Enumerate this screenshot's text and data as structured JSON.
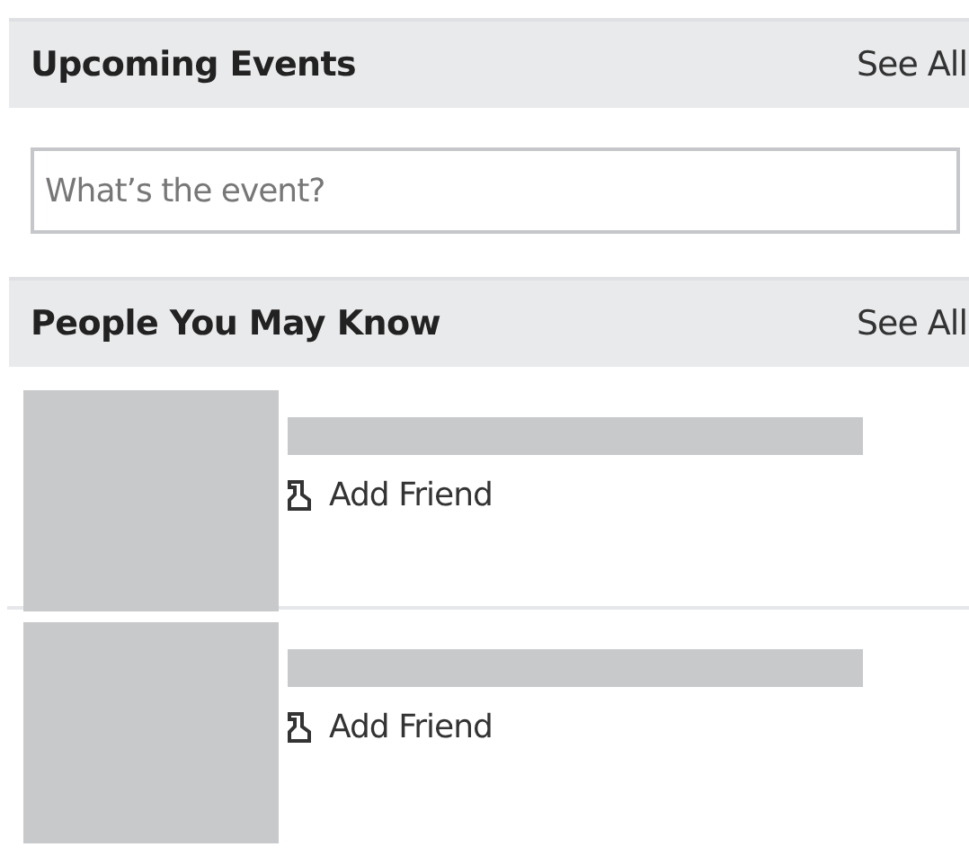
{
  "events": {
    "title": "Upcoming Events",
    "see_all": "See All",
    "placeholder": "What’s the event?"
  },
  "people_you_may_know": {
    "title": "People You May Know",
    "see_all": "See All",
    "people": [
      {
        "action": "Add Friend"
      },
      {
        "action": "Add Friend"
      }
    ]
  }
}
